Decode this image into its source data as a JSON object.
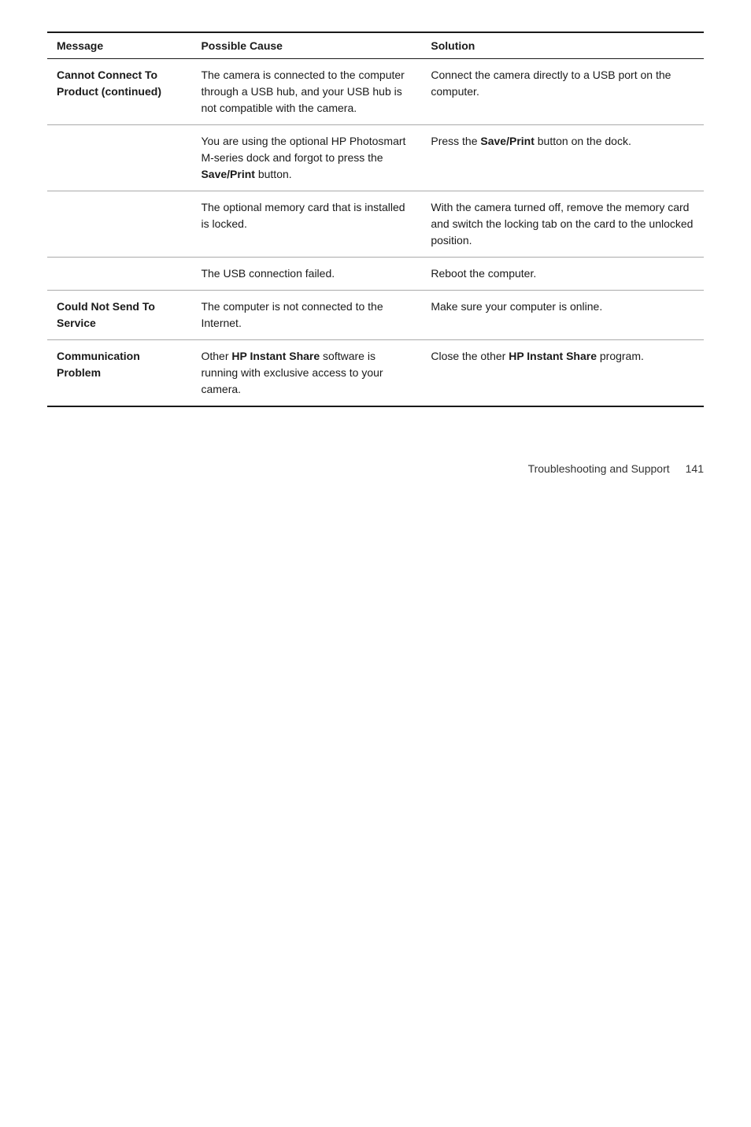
{
  "table": {
    "headers": [
      "Message",
      "Possible Cause",
      "Solution"
    ],
    "rows": [
      {
        "message": "Cannot Connect To Product (continued)",
        "cause": "The camera is connected to the computer through a USB hub, and your USB hub is not compatible with the camera.",
        "solution": "Connect the camera directly to a USB port on the computer.",
        "message_bold": true,
        "cause_bold_parts": [],
        "solution_bold_parts": []
      },
      {
        "message": "",
        "cause": "You are using the optional HP Photosmart M-series dock and forgot to press the Save/Print button.",
        "solution": "Press the Save/Print button on the dock.",
        "cause_has_bold": true,
        "cause_bold_word": "Save/Print",
        "solution_has_bold": true,
        "solution_bold_word": "Save/Print"
      },
      {
        "message": "",
        "cause": "The optional memory card that is installed is locked.",
        "solution": "With the camera turned off, remove the memory card and switch the locking tab on the card to the unlocked position."
      },
      {
        "message": "",
        "cause": "The USB connection failed.",
        "solution": "Reboot the computer."
      },
      {
        "message": "Could Not Send To Service",
        "cause": "The computer is not connected to the Internet.",
        "solution": "Make sure your computer is online.",
        "message_bold": true
      },
      {
        "message": "Communication Problem",
        "cause_prefix": "Other ",
        "cause_bold1": "HP Instant",
        "cause_middle": " ",
        "cause_bold2": "Share",
        "cause_suffix": " software is running with exclusive access to your camera.",
        "solution_prefix": "Close the other ",
        "solution_bold1": "HP Instant",
        "solution_middle": " ",
        "solution_bold2": "Share",
        "solution_suffix": " program.",
        "message_bold": true,
        "complex_cause": true,
        "complex_solution": true
      }
    ]
  },
  "footer": {
    "text": "Troubleshooting and Support",
    "page": "141"
  }
}
